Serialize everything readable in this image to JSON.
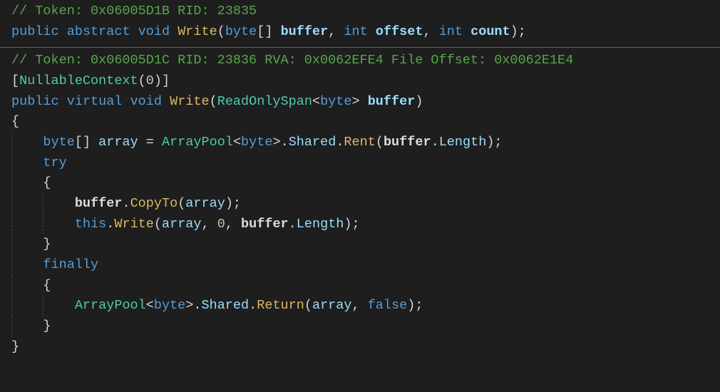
{
  "code": {
    "l1": {
      "comment": "// Token: 0x06005D1B RID: 23835"
    },
    "l2": {
      "kw_public": "public",
      "kw_abstract": "abstract",
      "kw_void": "void",
      "method": "Write",
      "p_open": "(",
      "t_byte": "byte",
      "arr": "[]",
      "sp": " ",
      "p_buffer": "buffer",
      "comma1": ",",
      "kw_int1": "int",
      "p_offset": "offset",
      "comma2": ",",
      "kw_int2": "int",
      "p_count": "count",
      "p_close": ")",
      "semi": ";"
    },
    "l3": {
      "comment": "// Token: 0x06005D1C RID: 23836 RVA: 0x0062EFE4 File Offset: 0x0062E1E4"
    },
    "l4": {
      "br_open": "[",
      "attr": "NullableContext",
      "p_open": "(",
      "num": "0",
      "p_close": ")",
      "br_close": "]"
    },
    "l5": {
      "kw_public": "public",
      "kw_virtual": "virtual",
      "kw_void": "void",
      "method": "Write",
      "p_open": "(",
      "t_ros": "ReadOnlySpan",
      "lt": "<",
      "t_byte": "byte",
      "gt": ">",
      "sp": " ",
      "p_buffer": "buffer",
      "p_close": ")"
    },
    "l6": {
      "brace": "{"
    },
    "l7": {
      "indent": "    ",
      "t_byte": "byte",
      "arr": "[]",
      "sp1": " ",
      "v_array": "array",
      "sp2": " ",
      "eq": "=",
      "sp3": " ",
      "t_pool": "ArrayPool",
      "lt": "<",
      "t_byte2": "byte",
      "gt": ">",
      "dot1": ".",
      "p_shared": "Shared",
      "dot2": ".",
      "m_rent": "Rent",
      "p_open": "(",
      "p_buffer": "buffer",
      "dot3": ".",
      "p_length": "Length",
      "p_close": ")",
      "semi": ";"
    },
    "l8": {
      "indent": "    ",
      "kw_try": "try"
    },
    "l9": {
      "indent": "    ",
      "brace": "{"
    },
    "l10": {
      "indent": "        ",
      "p_buffer": "buffer",
      "dot1": ".",
      "m_copy": "CopyTo",
      "p_open": "(",
      "v_array": "array",
      "p_close": ")",
      "semi": ";"
    },
    "l11": {
      "indent": "        ",
      "kw_this": "this",
      "dot1": ".",
      "m_write": "Write",
      "p_open": "(",
      "v_array": "array",
      "comma1": ",",
      "sp1": " ",
      "num0": "0",
      "comma2": ",",
      "sp2": " ",
      "p_buffer": "buffer",
      "dot2": ".",
      "p_length": "Length",
      "p_close": ")",
      "semi": ";"
    },
    "l12": {
      "indent": "    ",
      "brace": "}"
    },
    "l13": {
      "indent": "    ",
      "kw_finally": "finally"
    },
    "l14": {
      "indent": "    ",
      "brace": "{"
    },
    "l15": {
      "indent": "        ",
      "t_pool": "ArrayPool",
      "lt": "<",
      "t_byte": "byte",
      "gt": ">",
      "dot1": ".",
      "p_shared": "Shared",
      "dot2": ".",
      "m_return": "Return",
      "p_open": "(",
      "v_array": "array",
      "comma": ",",
      "sp": " ",
      "kw_false": "false",
      "p_close": ")",
      "semi": ";"
    },
    "l16": {
      "indent": "    ",
      "brace": "}"
    },
    "l17": {
      "brace": "}"
    }
  }
}
